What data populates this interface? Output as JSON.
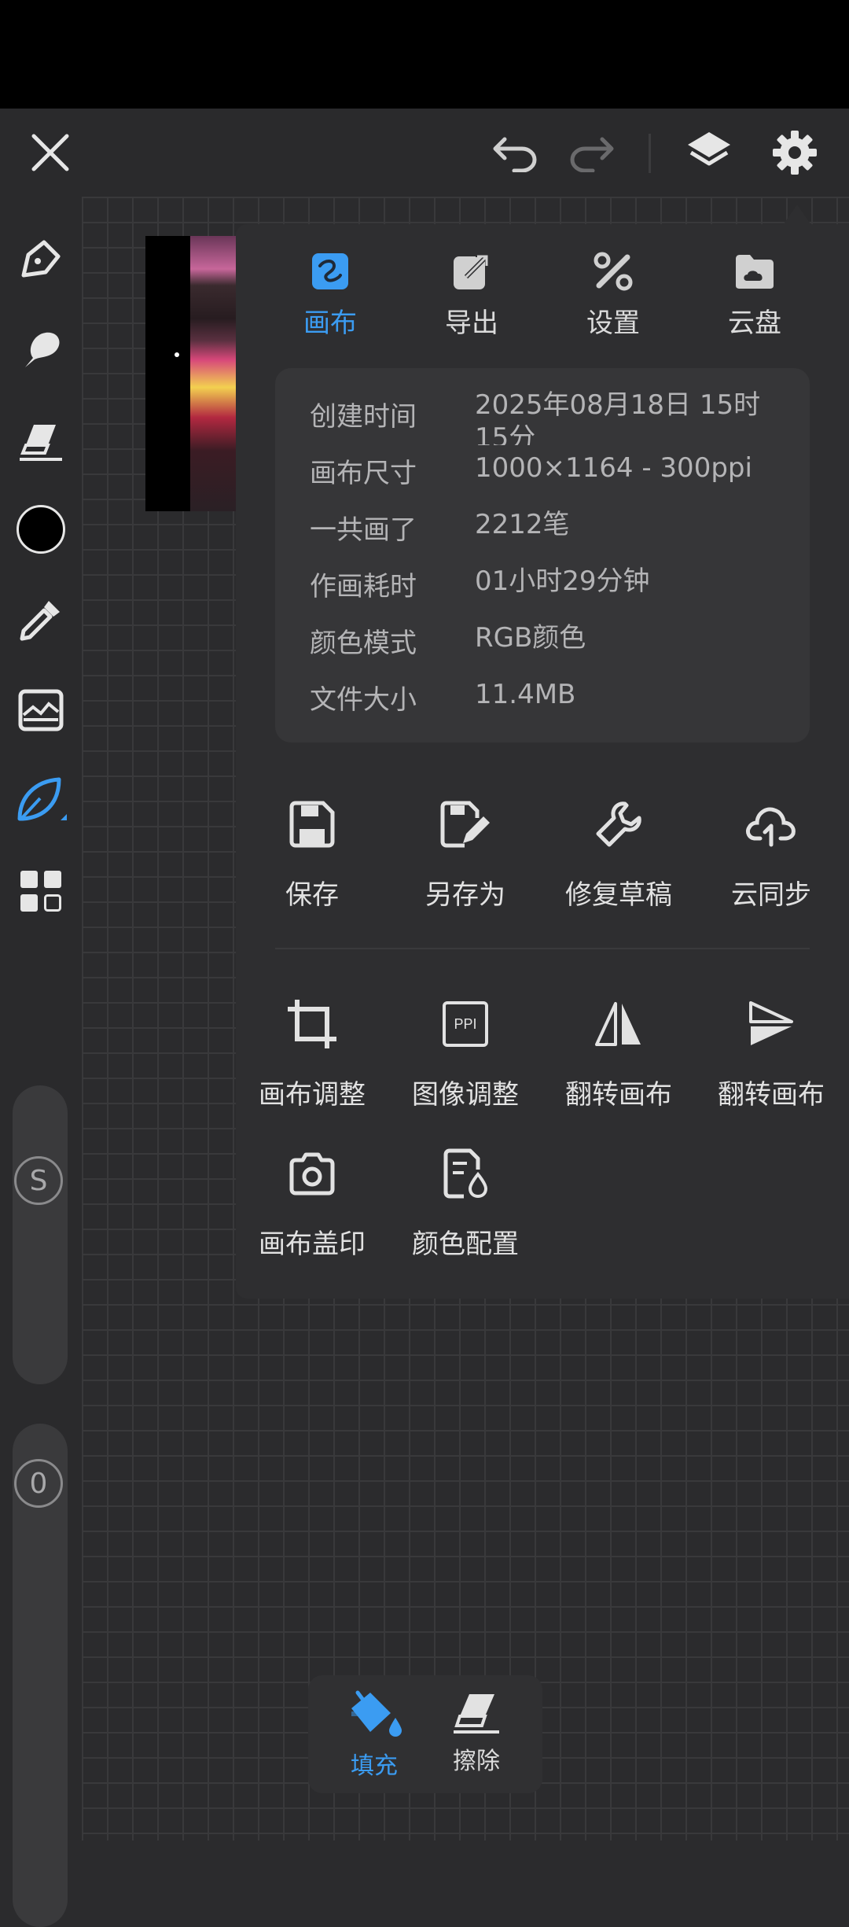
{
  "tabs": [
    {
      "label": "画布",
      "icon": "canvas-icon",
      "active": true
    },
    {
      "label": "导出",
      "icon": "export-icon",
      "active": false
    },
    {
      "label": "设置",
      "icon": "tools-icon",
      "active": false
    },
    {
      "label": "云盘",
      "icon": "cloud-drive-icon",
      "active": false
    }
  ],
  "info": [
    {
      "key": "创建时间",
      "value": "2025年08月18日 15时15分"
    },
    {
      "key": "画布尺寸",
      "value": "1000×1164 - 300ppi"
    },
    {
      "key": "一共画了",
      "value": "2212笔"
    },
    {
      "key": "作画耗时",
      "value": "01小时29分钟"
    },
    {
      "key": "颜色模式",
      "value": "RGB颜色"
    },
    {
      "key": "文件大小",
      "value": "11.4MB"
    }
  ],
  "actions_row1": [
    {
      "label": "保存",
      "icon": "save-icon"
    },
    {
      "label": "另存为",
      "icon": "save-as-icon"
    },
    {
      "label": "修复草稿",
      "icon": "repair-icon"
    },
    {
      "label": "云同步",
      "icon": "cloud-sync-icon"
    }
  ],
  "actions_row2": [
    {
      "label": "画布调整",
      "icon": "crop-icon"
    },
    {
      "label": "图像调整",
      "icon": "ppi-icon",
      "icon_text": "PPI"
    },
    {
      "label": "翻转画布",
      "icon": "flip-horizontal-icon"
    },
    {
      "label": "翻转画布",
      "icon": "flip-vertical-icon"
    }
  ],
  "actions_row3": [
    {
      "label": "画布盖印",
      "icon": "camera-icon"
    },
    {
      "label": "颜色配置",
      "icon": "color-profile-icon"
    }
  ],
  "sliders": {
    "size_label": "S",
    "opacity_label": "0"
  },
  "fill_toolbar": [
    {
      "label": "填充",
      "icon": "paint-bucket-icon",
      "active": true
    },
    {
      "label": "擦除",
      "icon": "eraser-icon",
      "active": false
    }
  ],
  "colors": {
    "accent": "#3b9cf2",
    "current_color": "#000000"
  }
}
